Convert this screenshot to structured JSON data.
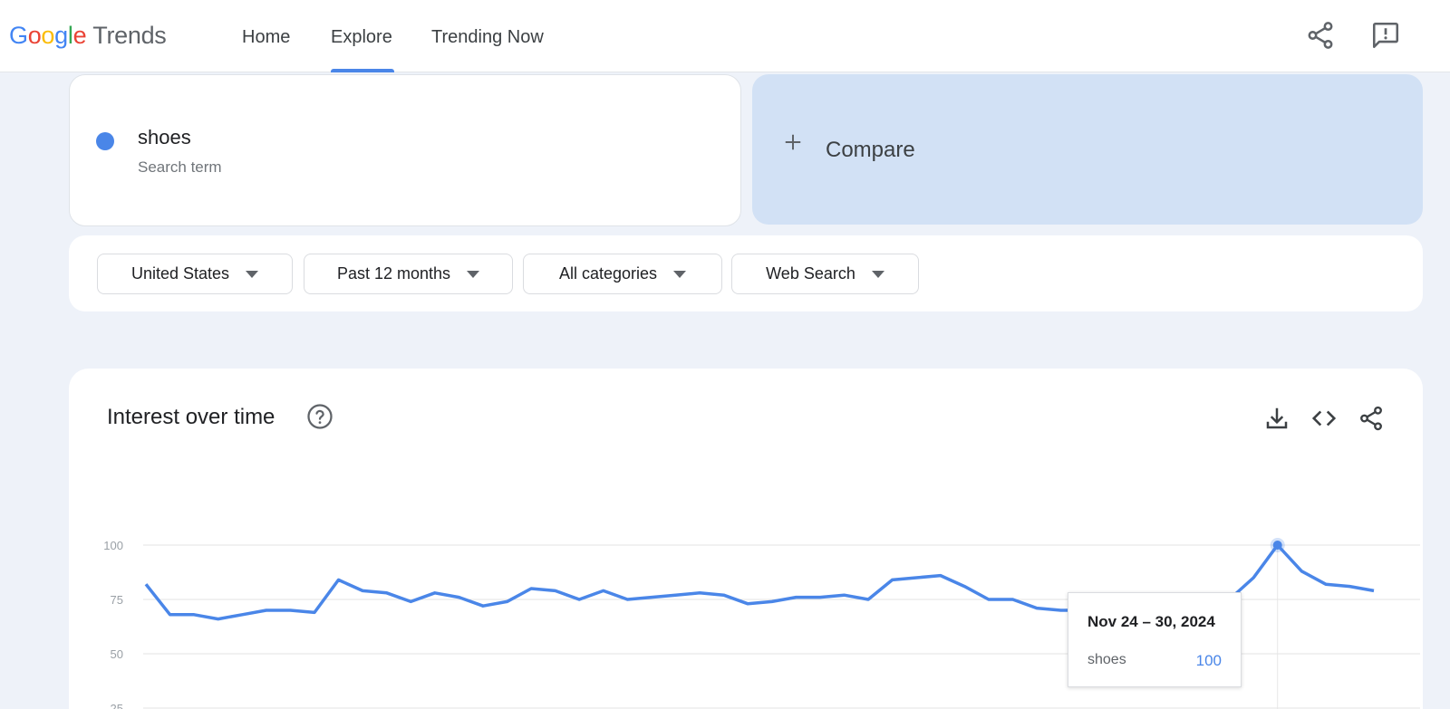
{
  "header": {
    "logo": {
      "letters": [
        "G",
        "o",
        "o",
        "g",
        "l",
        "e"
      ],
      "colors": [
        "#4285F4",
        "#EA4335",
        "#FBBC05",
        "#4285F4",
        "#34A853",
        "#EA4335"
      ],
      "product": "Trends"
    },
    "nav": [
      {
        "label": "Home",
        "active": false
      },
      {
        "label": "Explore",
        "active": true
      },
      {
        "label": "Trending Now",
        "active": false
      }
    ],
    "icons": [
      "share-icon",
      "feedback-icon"
    ]
  },
  "search": {
    "term": "shoes",
    "term_type": "Search term",
    "term_color": "#4a86e8",
    "compare_label": "Compare"
  },
  "filters": [
    {
      "label": "United States"
    },
    {
      "label": "Past 12 months"
    },
    {
      "label": "All categories"
    },
    {
      "label": "Web Search"
    }
  ],
  "chart_section": {
    "title": "Interest over time",
    "icons": [
      "help-icon",
      "download-icon",
      "embed-icon",
      "share-icon"
    ]
  },
  "chart_data": {
    "type": "line",
    "title": "Interest over time",
    "xlabel": "",
    "ylabel": "",
    "ylim": [
      0,
      100
    ],
    "y_ticks": [
      100,
      75,
      50,
      25
    ],
    "grid": true,
    "series": [
      {
        "name": "shoes",
        "color": "#4a86e8",
        "values": [
          82,
          68,
          68,
          66,
          68,
          70,
          70,
          69,
          84,
          79,
          78,
          74,
          78,
          76,
          72,
          74,
          80,
          79,
          75,
          79,
          75,
          76,
          77,
          78,
          77,
          73,
          74,
          76,
          76,
          77,
          75,
          84,
          85,
          86,
          81,
          75,
          75,
          71,
          70,
          70,
          68,
          68,
          71,
          74,
          68,
          75,
          85,
          100,
          88,
          82,
          81,
          79
        ]
      }
    ],
    "highlight_index": 47
  },
  "tooltip": {
    "date": "Nov 24 – 30, 2024",
    "term": "shoes",
    "value": "100"
  }
}
